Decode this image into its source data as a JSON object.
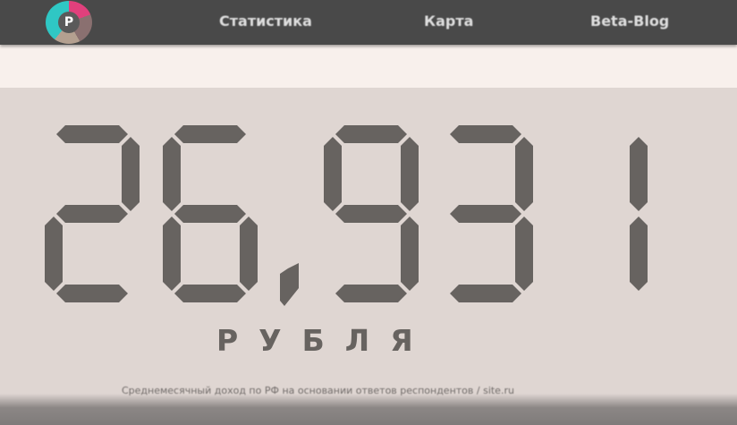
{
  "header": {
    "logo_letter": "P",
    "nav": [
      {
        "label": "Статистика"
      },
      {
        "label": "Карта"
      },
      {
        "label": "Beta-Blog"
      }
    ]
  },
  "display": {
    "value": "26,931",
    "unit": "РУБЛЯ",
    "segment_color": "#676360"
  },
  "caption": "Среднемесячный доход по РФ на основании ответов респондентов / site.ru"
}
